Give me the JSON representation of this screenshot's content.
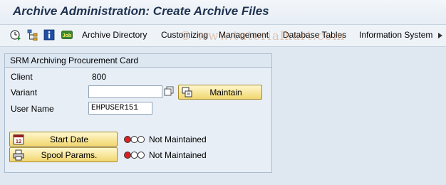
{
  "window": {
    "title": "Archive Administration: Create Archive Files"
  },
  "toolbar": {
    "icons": [
      "execute-clock-icon",
      "hierarchy-icon",
      "information-icon",
      "job-icon"
    ],
    "job_icon_text": "Job",
    "menu": [
      "Archive Directory",
      "Customizing",
      "Management",
      "Database Tables",
      "Information System"
    ]
  },
  "watermark": "© www.tutorialkart.com",
  "panel": {
    "title": "SRM Archiving Procurement Card",
    "client_label": "Client",
    "client_value": "800",
    "variant_label": "Variant",
    "variant_value": "",
    "maintain_label": "Maintain",
    "username_label": "User Name",
    "username_value": "EHPUSER151",
    "start_date_label": "Start Date",
    "spool_params_label": "Spool Params.",
    "start_date_status": "Not Maintained",
    "spool_status": "Not Maintained",
    "calendar_icon_text": "12"
  },
  "colors": {
    "status_red": "#e02020",
    "status_off": "#ffffff",
    "button_top": "#fff8cf",
    "button_bottom": "#f1d66f",
    "title_text": "#1e3250"
  }
}
